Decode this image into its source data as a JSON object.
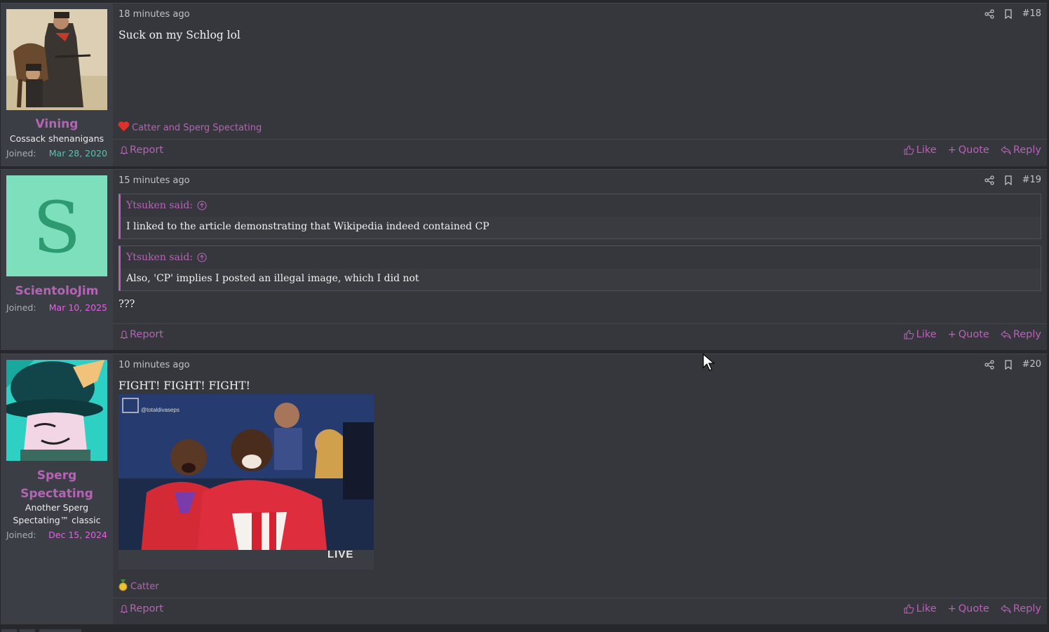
{
  "colors": {
    "accent": "#b564b5",
    "teal_date": "#5fbfb0",
    "pink_date": "#e262e2",
    "background": "#35373d",
    "user_cell": "#3b3e45"
  },
  "posts": [
    {
      "username": "Vining",
      "user_title": "Cossack shenanigans",
      "joined_label": "Joined:",
      "joined_date": "Mar 28, 2020",
      "time": "18 minutes ago",
      "number": "#18",
      "message": "Suck on my Schlog lol",
      "reactions": "Catter and Sperg Spectating",
      "reaction_icon": "heart-icon",
      "report": "Report",
      "like": "Like",
      "quote": "Quote",
      "reply": "Reply"
    },
    {
      "username": "ScientoloJim",
      "avatar_letter": "S",
      "joined_label": "Joined:",
      "joined_date": "Mar 10, 2025",
      "time": "15 minutes ago",
      "number": "#19",
      "quotes": [
        {
          "author": "Ytsuken said:",
          "text": "I linked to the article demonstrating that Wikipedia indeed contained CP"
        },
        {
          "author": "Ytsuken said:",
          "text": "Also, 'CP' implies I posted an illegal image, which I did not"
        }
      ],
      "message": "???",
      "report": "Report",
      "like": "Like",
      "quote": "Quote",
      "reply": "Reply"
    },
    {
      "username_line1": "Sperg",
      "username_line2": "Spectating",
      "user_title_line1": "Another Sperg",
      "user_title_line2": "Spectating™ classic",
      "joined_label": "Joined:",
      "joined_date": "Dec 15, 2024",
      "time": "10 minutes ago",
      "number": "#20",
      "message": "FIGHT! FIGHT! FIGHT!",
      "gif_watermark": "@totaldivaseps",
      "gif_badge": "LIVE",
      "reactions": "Catter",
      "reaction_icon": "medal-icon",
      "report": "Report",
      "like": "Like",
      "quote": "Quote",
      "reply": "Reply"
    }
  ]
}
